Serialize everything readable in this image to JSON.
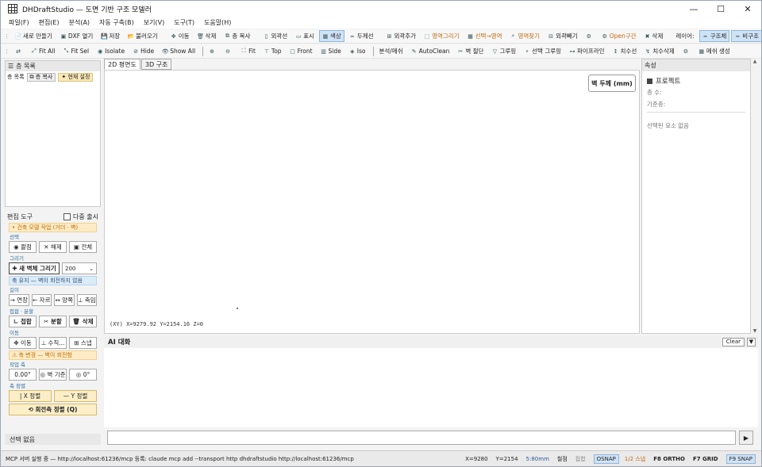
{
  "window": {
    "title": "DHDraftStudio — 도면 기반 구조 모델러",
    "minimize": "—",
    "maximize": "☐",
    "close": "✕"
  },
  "menu": [
    "파일(F)",
    "편집(E)",
    "분석(A)",
    "자동 구축(B)",
    "보기(V)",
    "도구(T)",
    "도움말(H)"
  ],
  "toolbar1": [
    {
      "icon": "📄",
      "label": "새로 만들기"
    },
    {
      "icon": "▣",
      "label": "DXF 열기"
    },
    {
      "icon": "💾",
      "label": "저장"
    },
    {
      "icon": "📂",
      "label": "불러오기"
    },
    {
      "icon": "✥",
      "label": "이동"
    },
    {
      "icon": "🗑",
      "label": "삭제"
    },
    {
      "icon": "⧉",
      "label": "층 복사"
    },
    {
      "icon": "▯",
      "label": "외곽선"
    },
    {
      "icon": "▭",
      "label": "표시"
    },
    {
      "icon": "▦",
      "label": "색상"
    },
    {
      "icon": "═",
      "label": "두께선"
    },
    {
      "icon": "⊞",
      "label": "외곽추가"
    },
    {
      "icon": "⬚",
      "label": "영역그리기"
    },
    {
      "icon": "▦",
      "label": "선택→영역"
    },
    {
      "icon": "⌕",
      "label": "영역찾기"
    },
    {
      "icon": "⊟",
      "label": "외곽빼기"
    },
    {
      "icon": "⚙",
      "label": ""
    },
    {
      "icon": "⚙",
      "label": "Open구간"
    },
    {
      "icon": "✖",
      "label": "삭제"
    }
  ],
  "toolbar1_layer": {
    "label": "레이어:",
    "structure": "구조체",
    "nonstructure": "비구조"
  },
  "toolbar2": [
    {
      "icon": "⇄",
      "label": ""
    },
    {
      "icon": "⤢",
      "label": "Fit All"
    },
    {
      "icon": "⤡",
      "label": "Fit Sel"
    },
    {
      "icon": "◉",
      "label": "Isolate"
    },
    {
      "icon": "⊘",
      "label": "Hide"
    },
    {
      "icon": "👁",
      "label": "Show All"
    },
    {
      "icon": "⊕",
      "label": ""
    },
    {
      "icon": "⊖",
      "label": ""
    },
    {
      "icon": "⛶",
      "label": "Fit"
    },
    {
      "icon": "⊤",
      "label": "Top"
    },
    {
      "icon": "▢",
      "label": "Front"
    },
    {
      "icon": "▥",
      "label": "Side"
    },
    {
      "icon": "◈",
      "label": "Iso"
    },
    {
      "icon": "",
      "label": "분석/메쉬"
    },
    {
      "icon": "✎",
      "label": "AutoClean"
    },
    {
      "icon": "✂",
      "label": "벽 절단"
    },
    {
      "icon": "▽",
      "label": "그루핑"
    },
    {
      "icon": "⚬",
      "label": "선택 그루핑"
    },
    {
      "icon": "⊶",
      "label": "파이프라인"
    },
    {
      "icon": "↕",
      "label": "치수선"
    },
    {
      "icon": "↯",
      "label": "치수삭제"
    },
    {
      "icon": "⚙",
      "label": ""
    },
    {
      "icon": "▦",
      "label": "메쉬 생성"
    }
  ],
  "floors": {
    "title": "층 목록",
    "row_label": "층 목록",
    "copy_label": "층 복사",
    "set_label": "현재 설정"
  },
  "tools": {
    "title": "편집 도구",
    "multi_label": "다중 출시",
    "banner_mode": "• 건축 모델 작업 (거더 · 벽)",
    "sec_select": "선택",
    "select_item": "◉ 콸점",
    "deselect": "✕ 해제",
    "select_all": "▣ 전체",
    "sec_draw": "그리기",
    "new_wall": "✚ 새 벽체 그리기",
    "thickness": "200",
    "banner_axis": "축 유지 — 벽이 회전하지 않음",
    "sec_length": "길이",
    "extend": "→ 연장",
    "trim": "← 자르",
    "both": "↔ 양쪽",
    "shrink": "⊥ 축임",
    "sec_split": "접합 · 분할",
    "join": "∟ 접합",
    "split": "✂ 분할",
    "delete": "🗑 삭제",
    "sec_move": "이동",
    "move": "✥ 이동",
    "vertical": "⊥ 수직...",
    "snap": "⊞ 스냅",
    "banner_axis2": "⚠ 축 변경 — 벽이 회전함",
    "sec_axis": "작업 축",
    "angle": "0.00°",
    "wall_ref": "◎ 벽 기준",
    "zero": "◎ 0°",
    "sec_align": "축 정렬",
    "x_align": "| X 정렬",
    "y_align": "— Y 정렬",
    "rot_align": "⟲ 회전축 정렬 (Q)"
  },
  "no_selection": "선택 없음",
  "viewtabs": [
    "2D 평면도",
    "3D 구조"
  ],
  "canvas": {
    "wall_thickness_btn": "벽 두께 (mm)",
    "coords": "(XY) X=9279.92  Y=2154.16  Z=0"
  },
  "properties": {
    "title": "속성",
    "project_label": "프로젝트",
    "floor_count": "층 수:",
    "base_floor": "기준층:",
    "none": "선택된 요소 없음"
  },
  "scroll": {
    "up": "▲",
    "down": "▼"
  },
  "ai": {
    "title": "AI 대화",
    "clear": "Clear",
    "menu": "▼",
    "send": "▶"
  },
  "status": {
    "mcp": "MCP 서버 실행 중 — http://localhost:61236/mcp    등록: claude mcp add --transport http dhdraftstudio http://localhost:61236/mcp",
    "x": "X=9280",
    "y": "Y=2154",
    "scale": "5:80mm",
    "join_label": "철점",
    "cross_label": "접합",
    "osnap": "OSNAP",
    "quarter": "1/2 스냅",
    "ortho": "F8 ORTHO",
    "grid": "F7 GRID",
    "snapkey": "F9 SNAP"
  },
  "colors": {
    "accent": "#cfe3f6",
    "warning": "#c06a10",
    "canvas": "#ffffff"
  }
}
